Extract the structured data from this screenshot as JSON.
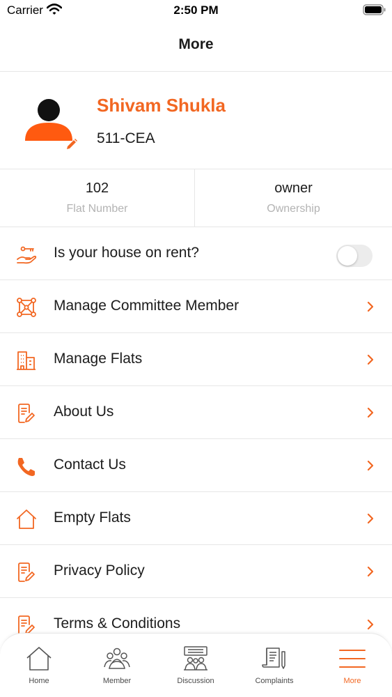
{
  "status_bar": {
    "carrier": "Carrier",
    "time": "2:50 PM"
  },
  "header": {
    "title": "More"
  },
  "profile": {
    "name": "Shivam Shukla",
    "unit": "511-CEA"
  },
  "stats": [
    {
      "value": "102",
      "label": "Flat Number"
    },
    {
      "value": "owner",
      "label": "Ownership"
    }
  ],
  "menu": {
    "rent": {
      "label": "Is your house on rent?",
      "toggle_on": false
    },
    "items": [
      {
        "label": "Manage Committee Member",
        "icon": "network-icon"
      },
      {
        "label": "Manage Flats",
        "icon": "building-icon"
      },
      {
        "label": "About Us",
        "icon": "document-edit-icon"
      },
      {
        "label": "Contact Us",
        "icon": "phone-icon"
      },
      {
        "label": "Empty Flats",
        "icon": "home-outline-icon"
      },
      {
        "label": "Privacy Policy",
        "icon": "document-edit-icon"
      },
      {
        "label": "Terms & Conditions",
        "icon": "document-edit-icon"
      }
    ]
  },
  "tabs": [
    {
      "label": "Home",
      "icon": "home-icon",
      "active": false
    },
    {
      "label": "Member",
      "icon": "members-icon",
      "active": false
    },
    {
      "label": "Discussion",
      "icon": "discussion-icon",
      "active": false
    },
    {
      "label": "Complaints",
      "icon": "complaints-icon",
      "active": false
    },
    {
      "label": "More",
      "icon": "menu-icon",
      "active": true
    }
  ],
  "colors": {
    "accent": "#f26722",
    "text": "#1c1c1c",
    "muted": "#b3b3b3",
    "divider": "#e6e6e6"
  }
}
